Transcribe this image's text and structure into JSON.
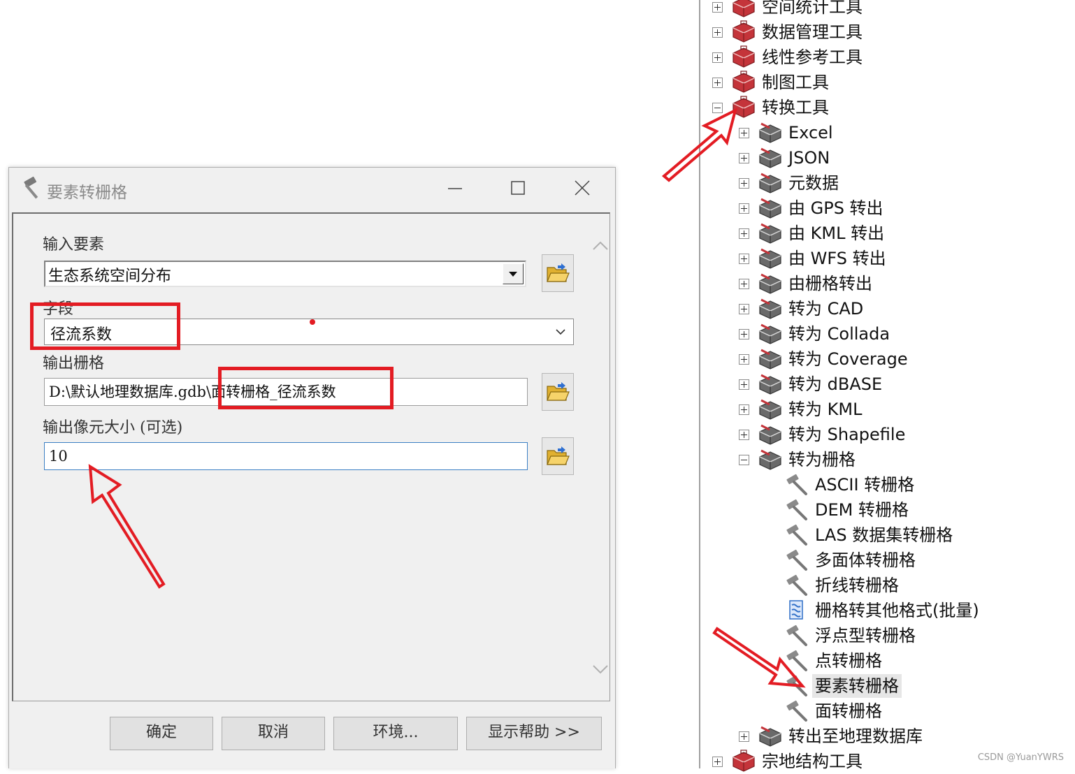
{
  "dialog": {
    "title": "要素转栅格",
    "input_features_label": "输入要素",
    "input_features_value": "生态系统空间分布",
    "field_label": "字段",
    "field_value": "径流系数",
    "output_raster_label": "输出栅格",
    "output_raster_value": "D:\\默认地理数据库.gdb\\面转栅格_径流系数",
    "cell_size_label": "输出像元大小 (可选)",
    "cell_size_value": "10",
    "buttons": {
      "ok": "确定",
      "cancel": "取消",
      "environments": "环境...",
      "show_help": "显示帮助 >>"
    }
  },
  "tree": {
    "toolsets": [
      {
        "label": "空间统计工具",
        "expanded": false
      },
      {
        "label": "数据管理工具",
        "expanded": false
      },
      {
        "label": "线性参考工具",
        "expanded": false
      },
      {
        "label": "制图工具",
        "expanded": false
      },
      {
        "label": "转换工具",
        "expanded": true
      },
      {
        "label": "宗地结构工具",
        "expanded": false
      }
    ],
    "conversion_children": [
      {
        "label": "Excel",
        "expanded": false
      },
      {
        "label": "JSON",
        "expanded": false
      },
      {
        "label": "元数据",
        "expanded": false
      },
      {
        "label": "由 GPS 转出",
        "expanded": false
      },
      {
        "label": "由 KML 转出",
        "expanded": false
      },
      {
        "label": "由 WFS 转出",
        "expanded": false
      },
      {
        "label": "由栅格转出",
        "expanded": false
      },
      {
        "label": "转为 CAD",
        "expanded": false
      },
      {
        "label": "转为 Collada",
        "expanded": false
      },
      {
        "label": "转为 Coverage",
        "expanded": false
      },
      {
        "label": "转为 dBASE",
        "expanded": false
      },
      {
        "label": "转为 KML",
        "expanded": false
      },
      {
        "label": "转为 Shapefile",
        "expanded": false
      },
      {
        "label": "转为栅格",
        "expanded": true
      },
      {
        "label": "转出至地理数据库",
        "expanded": false
      }
    ],
    "to_raster_tools": [
      {
        "label": "ASCII 转栅格",
        "icon": "hammer-icon"
      },
      {
        "label": "DEM 转栅格",
        "icon": "hammer-icon"
      },
      {
        "label": "LAS 数据集转栅格",
        "icon": "hammer-icon"
      },
      {
        "label": "多面体转栅格",
        "icon": "hammer-icon"
      },
      {
        "label": "折线转栅格",
        "icon": "hammer-icon"
      },
      {
        "label": "栅格转其他格式(批量)",
        "icon": "script-icon"
      },
      {
        "label": "浮点型转栅格",
        "icon": "hammer-icon"
      },
      {
        "label": "点转栅格",
        "icon": "hammer-icon"
      },
      {
        "label": "要素转栅格",
        "icon": "hammer-icon",
        "selected": true
      },
      {
        "label": "面转栅格",
        "icon": "hammer-icon"
      }
    ]
  },
  "watermark": "CSDN @YuanYWRS",
  "colors": {
    "annotation_red": "#e31c23",
    "focus_blue": "#3b7fc4",
    "toolbox_red": "#c4343a"
  }
}
